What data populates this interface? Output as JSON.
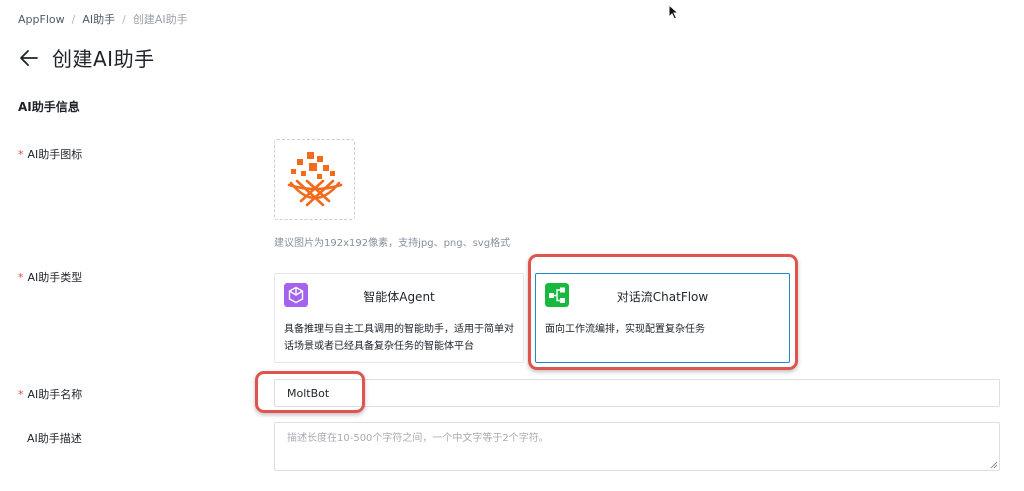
{
  "breadcrumb": {
    "items": [
      "AppFlow",
      "AI助手",
      "创建AI助手"
    ],
    "separator": "/"
  },
  "header": {
    "back_icon": "arrow-left-icon",
    "title": "创建AI助手"
  },
  "section": {
    "title": "AI助手信息"
  },
  "form": {
    "required_mark": "*",
    "icon_field": {
      "label": "AI助手图标",
      "hint": "建议图片为192x192像素，支持jpg、png、svg格式",
      "icon": "orange-nest-logo-icon"
    },
    "type_field": {
      "label": "AI助手类型",
      "options": [
        {
          "title": "智能体Agent",
          "description": "具备推理与自主工具调用的智能助手，适用于简单对话场景或者已经具备复杂任务的智能体平台",
          "icon": "cube-icon",
          "icon_color": "#a463ec",
          "selected": false
        },
        {
          "title": "对话流ChatFlow",
          "description": "面向工作流编排，实现配置复杂任务",
          "icon": "flow-icon",
          "icon_color": "#19b83f",
          "selected": true
        }
      ]
    },
    "name_field": {
      "label": "AI助手名称",
      "value": "MoltBot"
    },
    "description_field": {
      "label": "AI助手描述",
      "placeholder": "描述长度在10-500个字符之间，一个中文字等于2个字符。"
    }
  },
  "colors": {
    "highlight": "#e0544e",
    "selected_border": "#1e88c9",
    "required": "#e5484d",
    "logo_orange": "#f26a1b"
  }
}
